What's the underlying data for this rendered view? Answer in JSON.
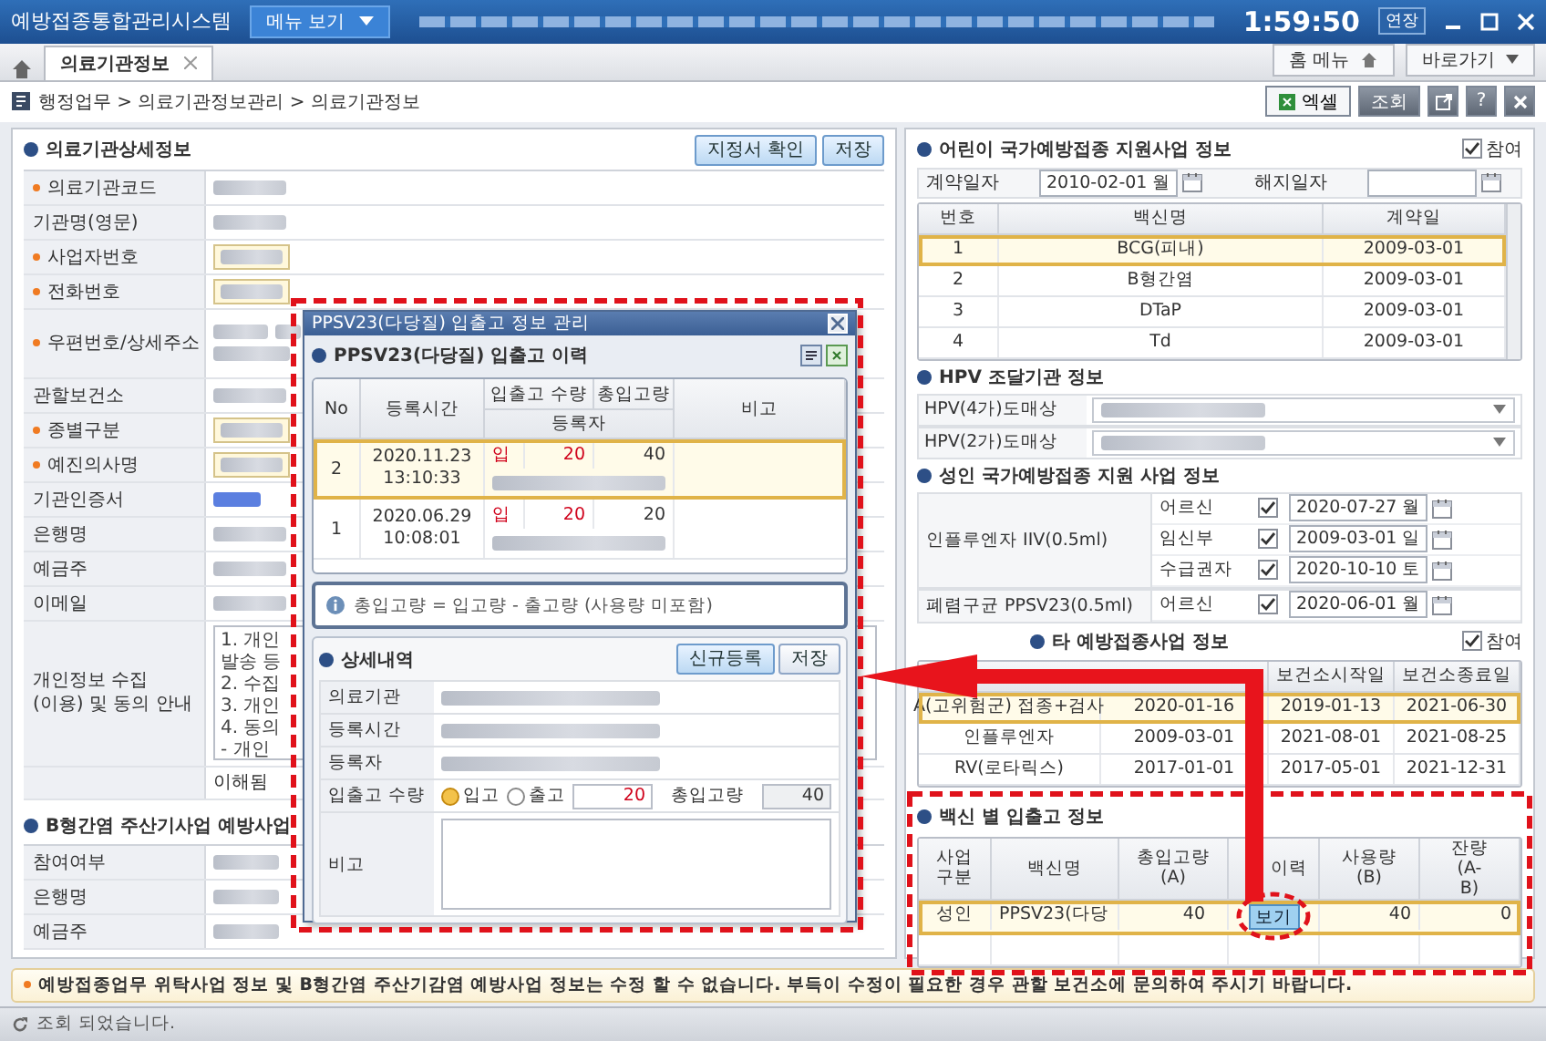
{
  "window": {
    "title": "예방접종통합관리시스템",
    "menu_button": "메뉴 보기",
    "clock": "1:59:50",
    "extend_button": "연장"
  },
  "tabs": [
    {
      "label": "의료기관정보",
      "selected": true
    }
  ],
  "quick_links": {
    "home_menu": "홈 메뉴",
    "shortcut": "바로가기"
  },
  "breadcrumb": "행정업무 > 의료기관정보관리 > 의료기관정보",
  "toolbar": {
    "excel": "엑셀",
    "search": "조회",
    "help": "?"
  },
  "institution": {
    "title": "의료기관상세정보",
    "buttons": [
      "지정서 확인",
      "저장"
    ],
    "rows": [
      {
        "label": "의료기관코드",
        "required": true,
        "kind": "text"
      },
      {
        "label": "기관명(영문)",
        "required": false,
        "kind": "text"
      },
      {
        "label": "사업자번호",
        "required": true,
        "kind": "input"
      },
      {
        "label": "전화번호",
        "required": true,
        "kind": "input"
      },
      {
        "label": "우편번호/상세주소",
        "required": true,
        "kind": "address"
      },
      {
        "label": "관할보건소",
        "required": false,
        "kind": "text"
      },
      {
        "label": "종별구분",
        "required": true,
        "kind": "input"
      },
      {
        "label": "예진의사명",
        "required": true,
        "kind": "input"
      },
      {
        "label": "기관인증서",
        "required": false,
        "kind": "link"
      },
      {
        "label": "은행명",
        "required": false,
        "kind": "text"
      },
      {
        "label": "예금주",
        "required": false,
        "kind": "text"
      },
      {
        "label": "이메일",
        "required": false,
        "kind": "text"
      }
    ],
    "consent": {
      "label": "개인정보 수집(이용) 및 동의 안내",
      "lines": [
        "1. 개인",
        "발송 등",
        "2. 수집",
        "3. 개인",
        "4. 동의",
        "- 개인"
      ],
      "agree": "이해됨"
    }
  },
  "hepatitis_b": {
    "title": "B형간염 주산기사업 예방사업",
    "rows": [
      {
        "label": "참여여부"
      },
      {
        "label": "은행명"
      },
      {
        "label": "예금주"
      }
    ]
  },
  "modal": {
    "title": "PPSV23(다당질) 입출고 정보 관리",
    "history_title": "PPSV23(다당질) 입출고 이력",
    "columns": [
      "No",
      "등록시간",
      "입출고 수량",
      "총입고량",
      "등록자",
      "비고"
    ],
    "rows": [
      {
        "no": "2",
        "date": "2020.11.23",
        "time": "13:10:33",
        "type": "입",
        "qty": "20",
        "total": "40",
        "selected": true
      },
      {
        "no": "1",
        "date": "2020.06.29",
        "time": "10:08:01",
        "type": "입",
        "qty": "20",
        "total": "20",
        "selected": false
      }
    ],
    "formula": "총입고량 = 입고량 - 출고량 (사용량 미포함)",
    "detail_title": "상세내역",
    "detail_buttons": [
      "신규등록",
      "저장"
    ],
    "fields": [
      {
        "label": "의료기관"
      },
      {
        "label": "등록시간"
      },
      {
        "label": "등록자"
      }
    ],
    "qty_label": "입출고 수량",
    "radios": [
      {
        "label": "입고",
        "selected": true
      },
      {
        "label": "출고",
        "selected": false
      }
    ],
    "qty_value": "20",
    "total_label": "총입고량",
    "total_value": "40",
    "note_label": "비고"
  },
  "children_program": {
    "title": "어린이 국가예방접종 지원사업 정보",
    "participate": {
      "label": "참여",
      "checked": true
    },
    "contract_label": "계약일자",
    "contract_date": "2010-02-01 월",
    "end_label": "해지일자",
    "columns": [
      "번호",
      "백신명",
      "계약일"
    ],
    "rows": [
      {
        "no": "1",
        "vaccine": "BCG(피내)",
        "date": "2009-03-01",
        "selected": true
      },
      {
        "no": "2",
        "vaccine": "B형간염",
        "date": "2009-03-01",
        "selected": false
      },
      {
        "no": "3",
        "vaccine": "DTaP",
        "date": "2009-03-01",
        "selected": false
      },
      {
        "no": "4",
        "vaccine": "Td",
        "date": "2009-03-01",
        "selected": false
      }
    ]
  },
  "hpv": {
    "title": "HPV 조달기관 정보",
    "rows": [
      {
        "label": "HPV(4가)도매상"
      },
      {
        "label": "HPV(2가)도매상"
      }
    ]
  },
  "adult_program": {
    "title": "성인 국가예방접종 지원 사업 정보",
    "groups": [
      {
        "label": "인플루엔자 IIV(0.5ml)",
        "items": [
          {
            "target": "어르신",
            "checked": true,
            "date": "2020-07-27 월"
          },
          {
            "target": "임신부",
            "checked": true,
            "date": "2009-03-01 일"
          },
          {
            "target": "수급권자",
            "checked": true,
            "date": "2020-10-10 토"
          }
        ]
      },
      {
        "label": "폐렴구균 PPSV23(0.5ml)",
        "items": [
          {
            "target": "어르신",
            "checked": true,
            "date": "2020-06-01 월"
          }
        ]
      }
    ]
  },
  "other_program": {
    "title": "타 예방접종사업 정보",
    "participate": {
      "label": "참여",
      "checked": true
    },
    "columns": [
      "보건소시작일",
      "보건소종료일"
    ],
    "rows": [
      {
        "column_1": "A(고위험군) 접종+검사",
        "column_2": "2020-01-16",
        "start": "2019-01-13",
        "end": "2021-06-30",
        "selected": true
      },
      {
        "column_1": "인플루엔자",
        "column_2": "2009-03-01",
        "start": "2021-08-01",
        "end": "2021-08-25",
        "selected": false
      },
      {
        "column_1": "RV(로타릭스)",
        "column_2": "2017-01-01",
        "start": "2017-05-01",
        "end": "2021-12-31",
        "selected": false
      }
    ]
  },
  "stock": {
    "title": "백신 별 입출고 정보",
    "columns": [
      "사업 구분",
      "백신명",
      "총입고량 (A)",
      "이력",
      "사용량 (B)",
      "잔량 (A-B)"
    ],
    "rows": [
      {
        "category": "성인",
        "vaccine": "PPSV23(다당",
        "total": "40",
        "history_button": "보기",
        "used": "40",
        "remain": "0",
        "selected": true
      }
    ]
  },
  "notice": "예방접종업무 위탁사업 정보 및 B형간염 주산기감염 예방사업 정보는 수정 할 수 없습니다. 부득이 수정이 필요한 경우 관할 보건소에 문의하여 주시기 바랍니다.",
  "status_bar": "조회 되었습니다."
}
